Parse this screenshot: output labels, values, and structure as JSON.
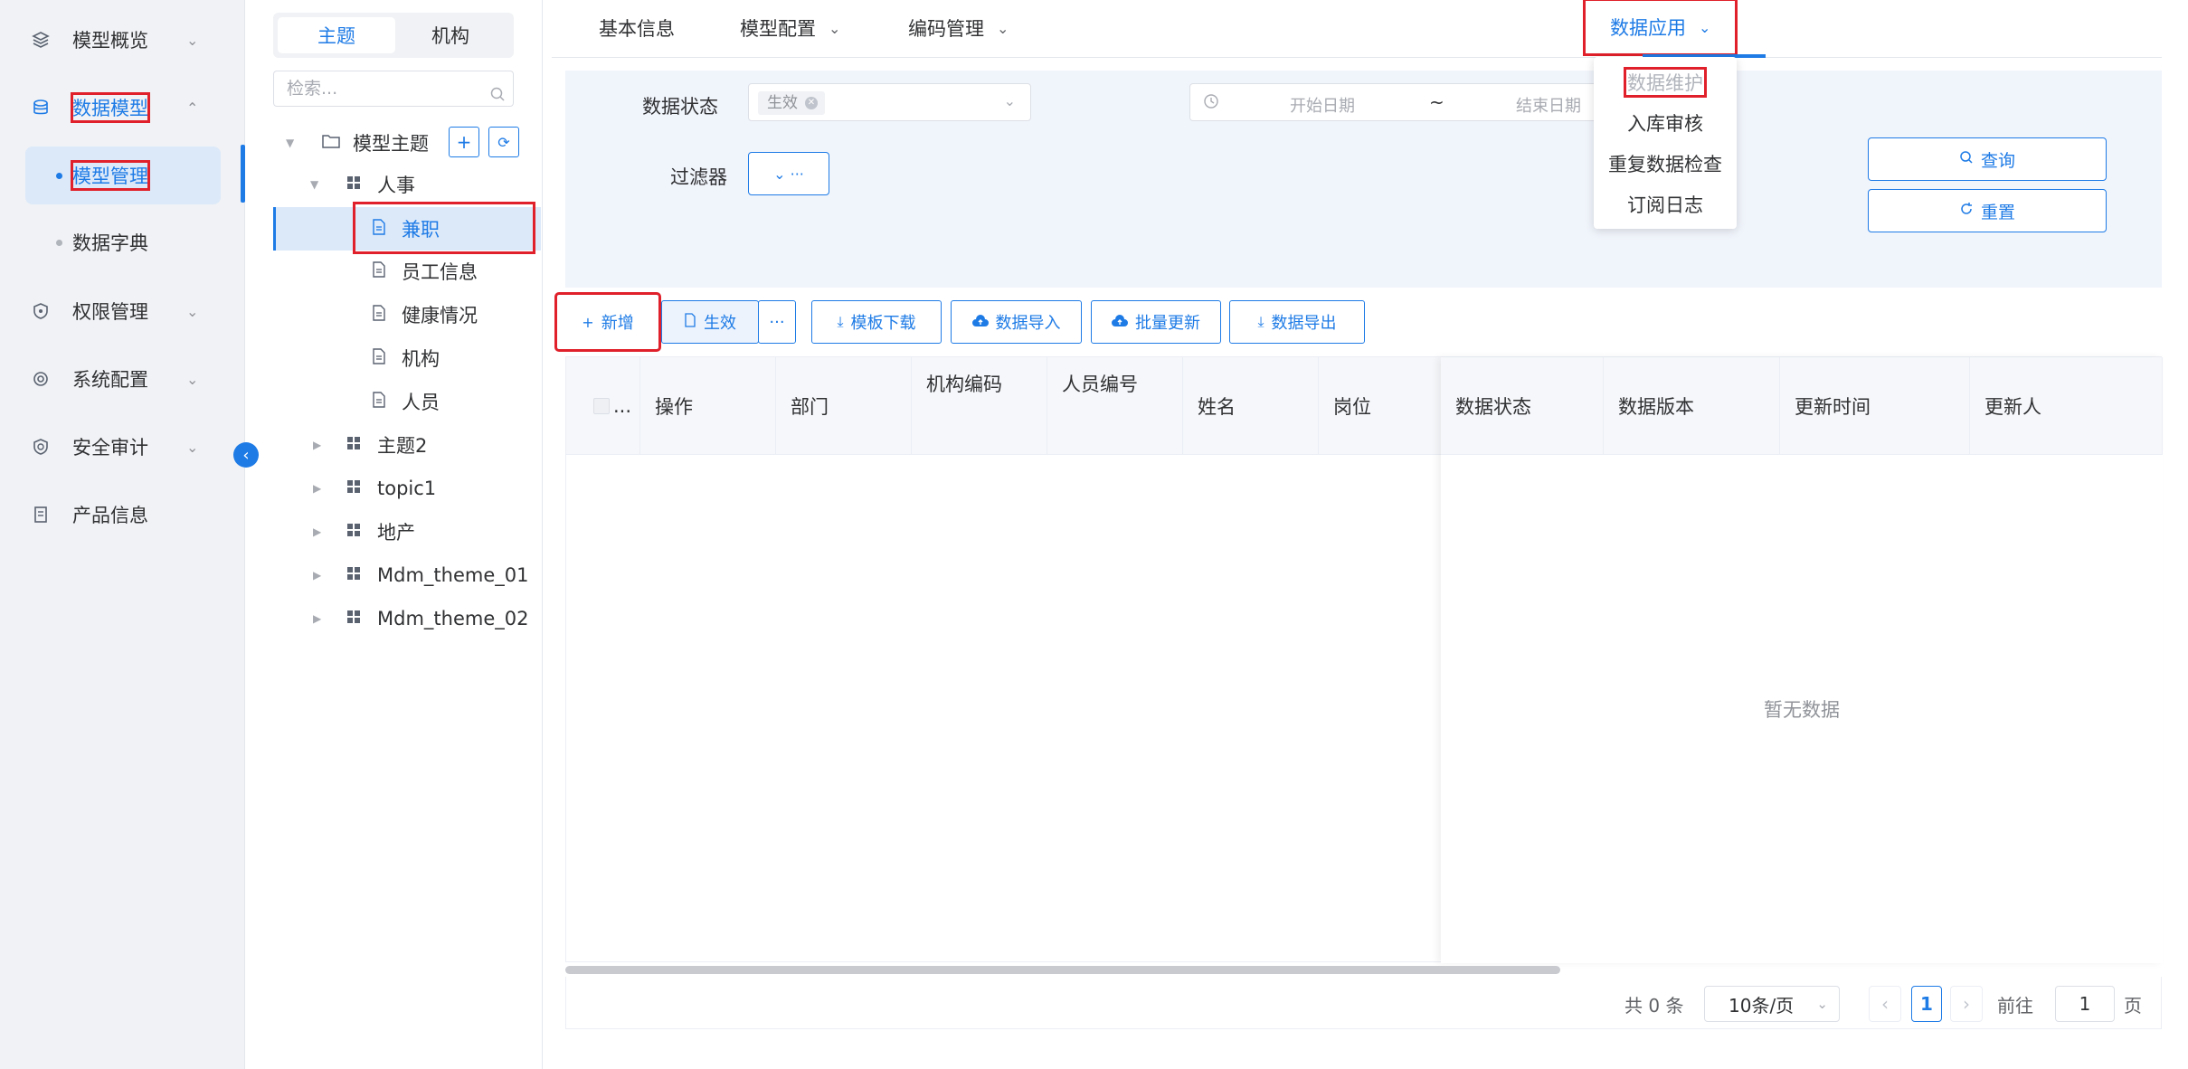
{
  "sidebar": {
    "items": [
      {
        "label": "模型概览",
        "icon": "layers-icon",
        "chevron": "⌄"
      },
      {
        "label": "数据模型",
        "icon": "database-icon",
        "chevron": "⌃"
      },
      {
        "label": "权限管理",
        "icon": "shield-icon",
        "chevron": "⌄"
      },
      {
        "label": "系统配置",
        "icon": "settings-icon",
        "chevron": "⌄"
      },
      {
        "label": "安全审计",
        "icon": "audit-shield-icon",
        "chevron": "⌄"
      },
      {
        "label": "产品信息",
        "icon": "document-icon",
        "chevron": ""
      }
    ],
    "subitems": [
      {
        "label": "模型管理",
        "active": true
      },
      {
        "label": "数据字典",
        "active": false
      }
    ],
    "collapse_glyph": "‹"
  },
  "tree": {
    "segments": [
      "主题",
      "机构"
    ],
    "search_placeholder": "检索...",
    "root_label": "模型主题",
    "add_glyph": "+",
    "refresh_glyph": "⟳",
    "nodes": [
      {
        "label": "人事"
      },
      {
        "label": "兼职"
      },
      {
        "label": "员工信息"
      },
      {
        "label": "健康情况"
      },
      {
        "label": "机构"
      },
      {
        "label": "人员"
      },
      {
        "label": "主题2"
      },
      {
        "label": "topic1"
      },
      {
        "label": "地产"
      },
      {
        "label": "Mdm_theme_01"
      },
      {
        "label": "Mdm_theme_02"
      }
    ]
  },
  "tabs": [
    "基本信息",
    "模型配置",
    "编码管理",
    "数据应用"
  ],
  "dropdown": [
    "数据维护",
    "入库审核",
    "重复数据检查",
    "订阅日志"
  ],
  "filter": {
    "status_label": "数据状态",
    "status_tag": "生效",
    "start_placeholder": "开始日期",
    "range_sep": "~",
    "end_placeholder": "结束日期",
    "filter_label": "过滤器",
    "filter_btn": "⌄ ···",
    "query_btn": "查询",
    "reset_btn": "重置"
  },
  "toolbar": {
    "add": "新增",
    "effective": "生效",
    "more": "···",
    "template_download": "模板下载",
    "import": "数据导入",
    "batch_update": "批量更新",
    "export": "数据导出"
  },
  "table": {
    "select_header": "...",
    "columns": [
      "操作",
      "部门",
      "机构编码",
      "人员编号",
      "姓名",
      "岗位"
    ],
    "right_columns": [
      "数据状态",
      "数据版本",
      "更新时间",
      "更新人"
    ],
    "empty_text": "暂无数据"
  },
  "pager": {
    "total": "共 0 条",
    "page_size": "10条/页",
    "prev": "‹",
    "current_page": "1",
    "next": "›",
    "goto_label": "前往",
    "goto_value": "1",
    "page_suffix": "页"
  },
  "colors": {
    "accent": "#1e7be6",
    "annotation": "#e0202a"
  }
}
